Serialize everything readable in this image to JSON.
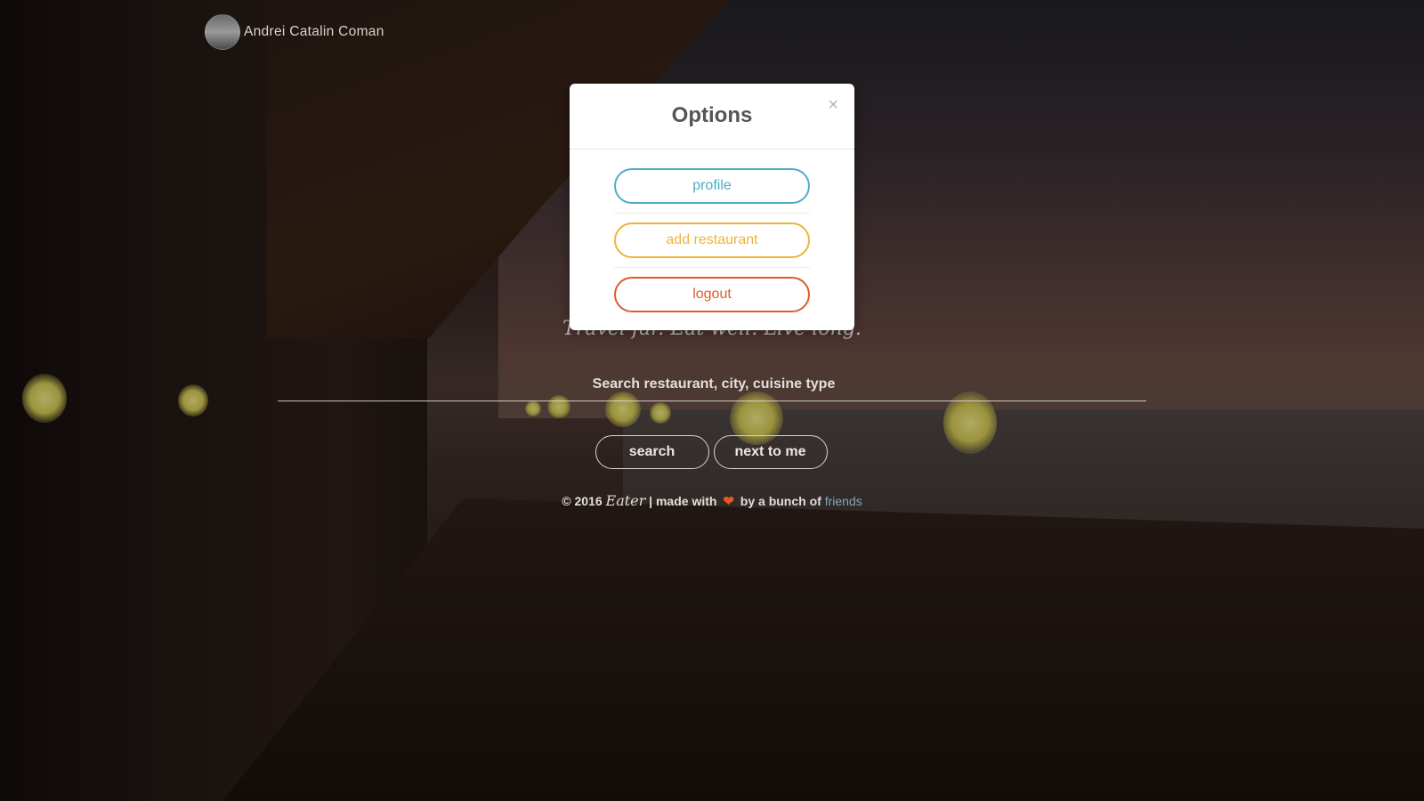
{
  "user": {
    "name": "Andrei Catalin Coman"
  },
  "hero": {
    "tagline": "Travel far. Eat well. Live long."
  },
  "search": {
    "placeholder": "Search restaurant, city, cuisine type",
    "value": "",
    "search_button": "search",
    "nearby_button": "next to me"
  },
  "footer": {
    "copyright": "© 2016",
    "brand": "Eater",
    "made_with": "| made with",
    "heart_icon": "heart-icon",
    "by_bunch": "by a bunch of",
    "friends_link": "friends"
  },
  "modal": {
    "title": "Options",
    "close": "×",
    "options": [
      {
        "label": "profile",
        "color": "#4fadc3"
      },
      {
        "label": "add restaurant",
        "color": "#f0b338"
      },
      {
        "label": "logout",
        "color": "#e2582a"
      }
    ]
  }
}
